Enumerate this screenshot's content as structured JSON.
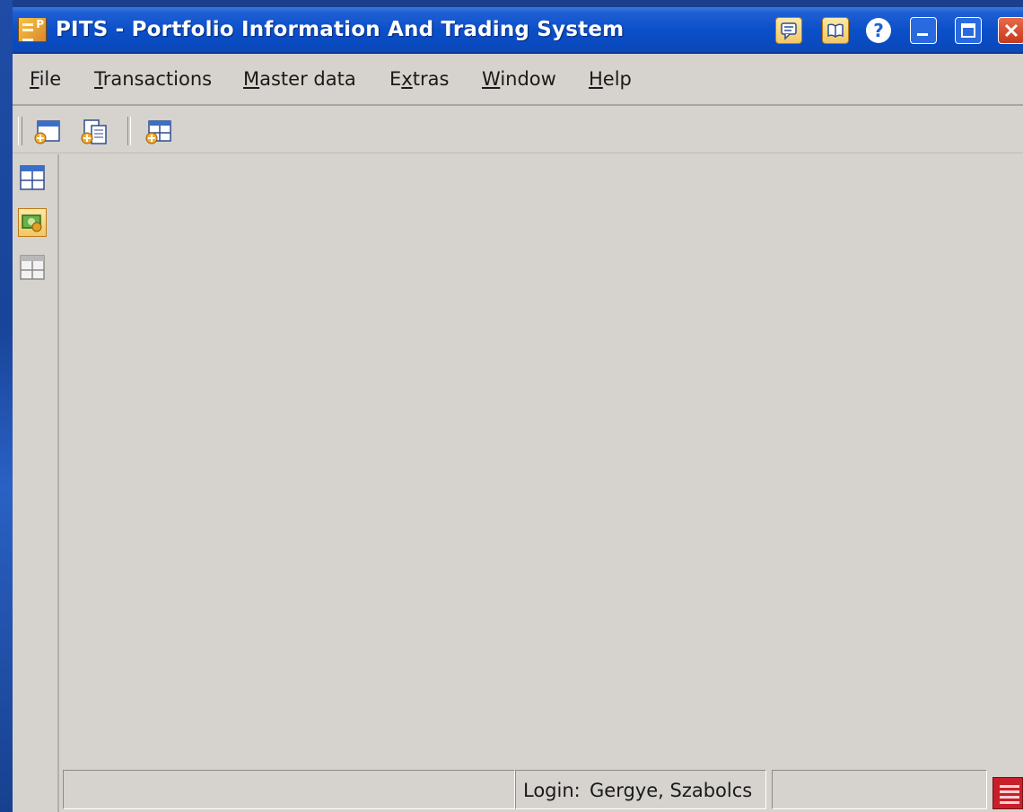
{
  "window": {
    "title": "PITS - Portfolio Information And Trading System",
    "app_icon_letter": "P"
  },
  "titlebar_buttons": [
    {
      "name": "message-icon"
    },
    {
      "name": "book-icon"
    },
    {
      "name": "help-icon",
      "label": "?"
    },
    {
      "name": "minimize-icon"
    },
    {
      "name": "maximize-icon"
    },
    {
      "name": "close-icon"
    }
  ],
  "menu": {
    "items": [
      "File",
      "Transactions",
      "Master data",
      "Extras",
      "Window",
      "Help"
    ],
    "mnemonics": [
      "F",
      "T",
      "M",
      "x",
      "W",
      "H"
    ]
  },
  "toolbar": {
    "buttons": [
      "new-window-icon",
      "copy-document-icon",
      "new-grid-icon"
    ]
  },
  "sidebar": {
    "buttons": [
      "grid-view-icon",
      "money-icon",
      "grid-inactive-icon"
    ]
  },
  "status": {
    "login_label": "Login:",
    "login_user": "Gergye, Szabolcs"
  },
  "colors": {
    "titlebar": "#0b4fc9",
    "window_bg": "#d6d3ce",
    "close_button": "#c63a1c",
    "status_icon": "#c8202a"
  }
}
